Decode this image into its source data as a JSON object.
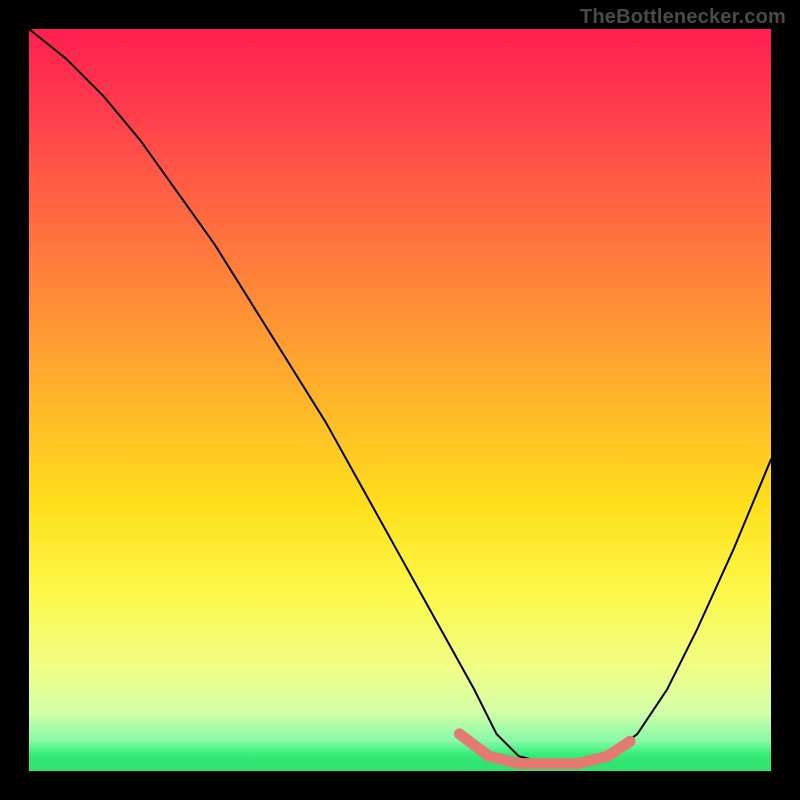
{
  "attribution": "TheBottlenecker.com",
  "chart_data": {
    "type": "line",
    "title": "",
    "xlabel": "",
    "ylabel": "",
    "xlim": [
      0,
      100
    ],
    "ylim": [
      0,
      100
    ],
    "series": [
      {
        "name": "bottleneck-curve",
        "x": [
          0,
          5,
          10,
          15,
          20,
          25,
          30,
          35,
          40,
          45,
          50,
          55,
          60,
          63,
          66,
          70,
          74,
          78,
          82,
          86,
          90,
          95,
          100
        ],
        "values": [
          100,
          96,
          91,
          85,
          78,
          71,
          63,
          55,
          47,
          38,
          29,
          20,
          11,
          5,
          2,
          1,
          1,
          2,
          5,
          11,
          19,
          30,
          42
        ]
      }
    ],
    "optimal_band": {
      "name": "optimal-range",
      "x": [
        58,
        62,
        66,
        70,
        74,
        78,
        81
      ],
      "values": [
        5,
        2,
        1,
        1,
        1,
        2,
        4
      ]
    },
    "gradient_note": "background encodes bottleneck severity: red high, green low"
  }
}
